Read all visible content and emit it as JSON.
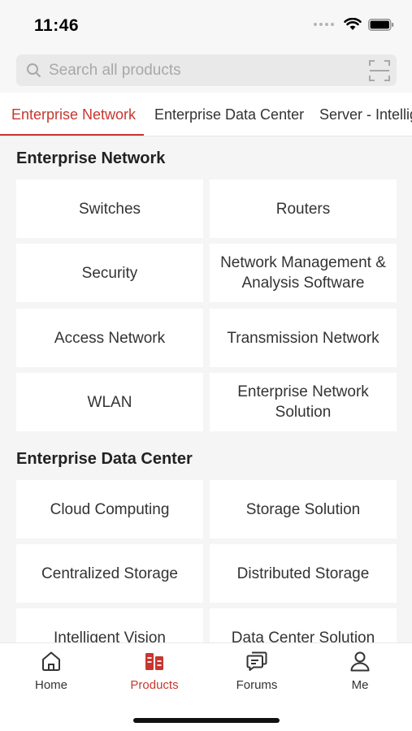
{
  "status_bar": {
    "time": "11:46"
  },
  "search": {
    "placeholder": "Search all products"
  },
  "tabs": [
    {
      "label": "Enterprise Network",
      "active": true
    },
    {
      "label": "Enterprise Data Center",
      "active": false
    },
    {
      "label": "Server - Intellig",
      "active": false
    }
  ],
  "sections": [
    {
      "title": "Enterprise Network",
      "items": [
        "Switches",
        "Routers",
        "Security",
        "Network Management & Analysis Software",
        "Access Network",
        "Transmission Network",
        "WLAN",
        "Enterprise Network Solution"
      ]
    },
    {
      "title": "Enterprise Data Center",
      "items": [
        "Cloud Computing",
        "Storage Solution",
        "Centralized Storage",
        "Distributed Storage",
        "Intelligent Vision",
        "Data Center Solution"
      ]
    }
  ],
  "bottom_nav": [
    {
      "label": "Home",
      "icon": "home-icon",
      "active": false
    },
    {
      "label": "Products",
      "icon": "products-icon",
      "active": true
    },
    {
      "label": "Forums",
      "icon": "forums-icon",
      "active": false
    },
    {
      "label": "Me",
      "icon": "person-icon",
      "active": false
    }
  ],
  "colors": {
    "accent": "#c7372f",
    "background": "#f5f5f5",
    "card": "#ffffff"
  }
}
